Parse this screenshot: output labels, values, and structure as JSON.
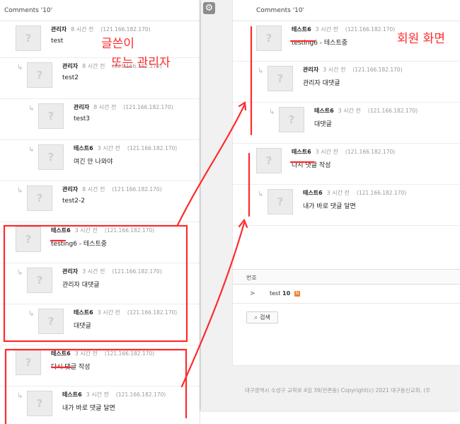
{
  "left": {
    "header": "Comments '10'",
    "comments": [
      {
        "author": "관리자",
        "time": "8 시간 전",
        "ip": "(121.166.182.170)",
        "text": "test",
        "level": 0
      },
      {
        "author": "관리자",
        "time": "8 시간 전",
        "ip": "(121.166.182.170)",
        "text": "test2",
        "level": 1
      },
      {
        "author": "관리자",
        "time": "8 시간 전",
        "ip": "(121.166.182.170)",
        "text": "test3",
        "level": 2
      },
      {
        "author": "테스트6",
        "time": "3 시간 전",
        "ip": "(121.166.182.170)",
        "text": "여긴 안 나와야",
        "level": 2
      },
      {
        "author": "관리자",
        "time": "8 시간 전",
        "ip": "(121.166.182.170)",
        "text": "test2-2",
        "level": 1
      },
      {
        "author": "테스트6",
        "time": "3 시간 전",
        "ip": "(121.166.182.170)",
        "text": "testing6 - 테스트중",
        "level": 0
      },
      {
        "author": "관리자",
        "time": "3 시간 전",
        "ip": "(121.166.182.170)",
        "text": "관리자 대댓글",
        "level": 1
      },
      {
        "author": "테스트6",
        "time": "3 시간 전",
        "ip": "(121.166.182.170)",
        "text": "대댓글",
        "level": 2
      },
      {
        "author": "테스트6",
        "time": "3 시간 전",
        "ip": "(121.166.182.170)",
        "text": "다시 댓글 작성",
        "level": 0
      },
      {
        "author": "테스트6",
        "time": "3 시간 전",
        "ip": "(121.166.182.170)",
        "text": "내가 바로 댓글 달면",
        "level": 1
      }
    ]
  },
  "right": {
    "header": "Comments '10'",
    "comments": [
      {
        "author": "테스트6",
        "time": "3 시간 전",
        "ip": "(121.166.182.170)",
        "text": "testing6 - 테스트중",
        "level": 0
      },
      {
        "author": "관리자",
        "time": "3 시간 전",
        "ip": "(121.166.182.170)",
        "text": "관리자 대댓글",
        "level": 1
      },
      {
        "author": "테스트6",
        "time": "3 시간 전",
        "ip": "(121.166.182.170)",
        "text": "대댓글",
        "level": 2
      },
      {
        "author": "테스트6",
        "time": "3 시간 전",
        "ip": "(121.166.182.170)",
        "text": "다시 댓글 작성",
        "level": 0
      },
      {
        "author": "테스트6",
        "time": "3 시간 전",
        "ip": "(121.166.182.170)",
        "text": "내가 바로 댓글 달면",
        "level": 1
      }
    ],
    "board": {
      "column_number": "번호",
      "row_chevron": ">",
      "row_title": "test",
      "row_count": "10",
      "row_badge": "N",
      "search_label": "검색"
    },
    "footer": "대구광역시 수성구 교학로 4길 39(만촌동) Copyright(c) 2021 대구동신교회. (우"
  },
  "avatar_glyph": "?",
  "reply_arrow": "↳",
  "gear_icon": "⚙",
  "annotations": {
    "left_label_line1": "글쓴이",
    "left_label_line2": "또는 관리자",
    "right_label": "회원 화면"
  },
  "colors": {
    "annotation_red": "#ff2a2a"
  }
}
